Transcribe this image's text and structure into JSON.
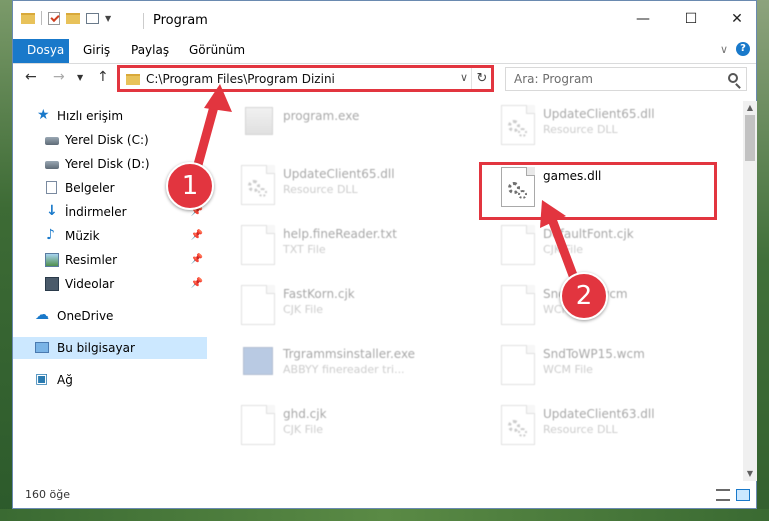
{
  "window": {
    "title": "Program"
  },
  "ribbon": {
    "tabs": [
      {
        "label": "Dosya"
      },
      {
        "label": "Giriş"
      },
      {
        "label": "Paylaş"
      },
      {
        "label": "Görünüm"
      }
    ]
  },
  "address": {
    "path": "C:\\Program Files\\Program Dizini"
  },
  "search": {
    "placeholder": "Ara: Program"
  },
  "navpane": {
    "quick_access": "Hızlı erişim",
    "items": [
      {
        "label": "Yerel Disk (C:)"
      },
      {
        "label": "Yerel Disk (D:)"
      },
      {
        "label": "Belgeler"
      },
      {
        "label": "İndirmeler"
      },
      {
        "label": "Müzik"
      },
      {
        "label": "Resimler"
      },
      {
        "label": "Videolar"
      }
    ],
    "onedrive": "OneDrive",
    "this_pc": "Bu bilgisayar",
    "network": "Ağ"
  },
  "files": [
    {
      "name": "program.exe",
      "type": ""
    },
    {
      "name": "UpdateClient65.dll",
      "type": "Resource DLL"
    },
    {
      "name": "UpdateClient65.dll",
      "type": "Resource DLL"
    },
    {
      "name": "games.dll",
      "type": ""
    },
    {
      "name": "help.fineReader.txt",
      "type": "TXT File"
    },
    {
      "name": "DefaultFont.cjk",
      "type": "CJK File"
    },
    {
      "name": "FastKorn.cjk",
      "type": "CJK File"
    },
    {
      "name": "SndToWP.wcm",
      "type": "WCM File"
    },
    {
      "name": "Trgrammsinstaller.exe",
      "type": "ABBYY finereader tri..."
    },
    {
      "name": "SndToWP15.wcm",
      "type": "WCM File"
    },
    {
      "name": "ghd.cjk",
      "type": "CJK File"
    },
    {
      "name": "UpdateClient63.dll",
      "type": "Resource DLL"
    }
  ],
  "status": {
    "count": "160 öğe"
  },
  "annotations": {
    "badge1": "1",
    "badge2": "2"
  },
  "colors": {
    "accent": "#1979ca",
    "highlight": "#e2353f"
  }
}
